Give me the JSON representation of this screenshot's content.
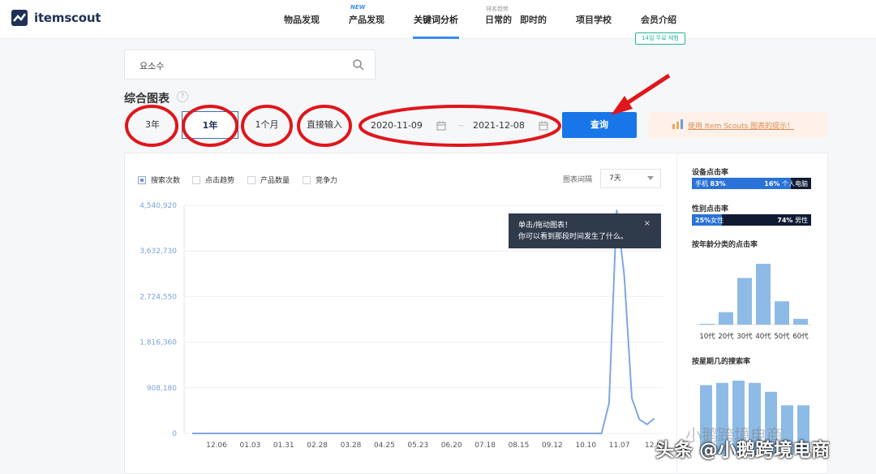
{
  "header": {
    "logo_text": "itemscout",
    "nav": [
      {
        "label": "物品发现"
      },
      {
        "label": "产品发现",
        "badge": "NEW"
      },
      {
        "label": "关键词分析",
        "active": true
      },
      {
        "label": "日常的",
        "sub": "排名趋势"
      },
      {
        "label": "即时的"
      },
      {
        "label": "项目学校"
      },
      {
        "label": "会员介绍",
        "badge": "14일 무료 체험"
      }
    ]
  },
  "search": {
    "value": "요소수",
    "icon": "search-icon"
  },
  "section_title": "综合图表",
  "help_mark": "?",
  "range_buttons": [
    "3年",
    "1年",
    "1个月",
    "直接输入"
  ],
  "active_range": "1年",
  "date_range": {
    "start": "2020-11-09",
    "separator": "~",
    "end": "2021-12-08"
  },
  "query_button": "查询",
  "tip_link": "使用 Item Scouts 图表的提示！",
  "legend": [
    {
      "label": "搜索次数",
      "checked": true
    },
    {
      "label": "点击趋势",
      "checked": false
    },
    {
      "label": "产品数量",
      "checked": false
    },
    {
      "label": "竞争力",
      "checked": false
    }
  ],
  "interval": {
    "label": "图表间隔",
    "value": "7天"
  },
  "tooltip": {
    "line1": "单击/拖动图表！",
    "line2": "你可以看到那段时间发生了什么。",
    "close": "×"
  },
  "colors": {
    "accent": "#1976e8",
    "line": "#7fa6e3",
    "annotation": "#e0161b",
    "bar": "#8dbbe6",
    "dark": "#0f1b33"
  },
  "side_panel": {
    "device_title": "设备点击率",
    "device": {
      "left_label": "手机",
      "left_pct": "83%",
      "right_pct": "16%",
      "right_label": "个人电脑",
      "left_share": 0.83
    },
    "gender_title": "性别点击率",
    "gender": {
      "left_pct": "25%",
      "left_label": "女性",
      "right_pct": "74%",
      "right_label": "男性",
      "left_share": 0.25
    },
    "age_title": "按年龄分类的点击率",
    "weekday_title": "按星期几的搜索率"
  },
  "watermark": "头条 @小鹅跨境电商",
  "watermark_faint": "小鹅跨境电商",
  "chart_data": [
    {
      "type": "line",
      "series": [
        {
          "name": "搜索次数",
          "values": [
            0,
            0,
            0,
            0,
            0,
            0,
            0,
            0,
            0,
            0,
            0,
            0,
            0,
            0,
            0,
            0,
            0,
            0,
            0,
            0,
            0,
            0,
            0,
            0,
            0,
            0,
            0,
            0,
            0,
            0,
            0,
            0,
            0,
            0,
            0,
            0,
            0,
            0,
            0,
            0,
            0,
            0,
            0,
            0,
            0,
            0,
            0,
            0,
            0,
            0,
            0,
            0,
            0,
            0,
            0,
            600000,
            4450000,
            3150000,
            700000,
            280000,
            180000,
            300000
          ]
        }
      ],
      "x_tick_labels": [
        "12.06",
        "01.03",
        "01.31",
        "02.28",
        "03.28",
        "04.25",
        "05.23",
        "06.20",
        "07.18",
        "08.15",
        "09.12",
        "10.10",
        "11.07",
        "12.0"
      ],
      "y_ticks": [
        "0",
        "908,180",
        "1,816,360",
        "2,724,550",
        "3,632,730",
        "4,540,920"
      ],
      "ylim": [
        0,
        4540920
      ],
      "grid": true
    },
    {
      "type": "bar",
      "title": "按年龄分类的点击率",
      "categories": [
        "10代",
        "20代",
        "30代",
        "40代",
        "50代",
        "60代"
      ],
      "values": [
        1,
        15,
        56,
        73,
        28,
        7
      ]
    },
    {
      "type": "bar",
      "title": "按星期几的搜索率",
      "values": [
        15.5,
        16,
        16.5,
        16,
        14,
        11,
        11
      ]
    }
  ]
}
